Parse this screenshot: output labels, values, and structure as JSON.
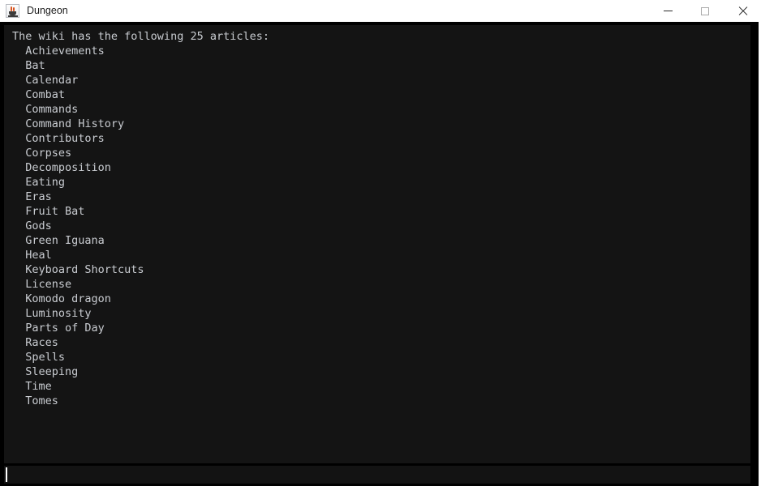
{
  "window": {
    "title": "Dungeon",
    "icon": "java-coffee-cup-icon",
    "colors": {
      "titlebar_bg": "#ffffff",
      "frame": "#000000",
      "console_bg": "#141414",
      "console_fg": "#c9ccd1",
      "input_bg": "#131313",
      "caret": "#ffffff"
    },
    "controls": {
      "minimize": "—",
      "maximize": "□",
      "close": "✕"
    }
  },
  "console": {
    "header": "The wiki has the following 25 articles:",
    "article_count": 25,
    "indent": "  ",
    "articles": [
      "Achievements",
      "Bat",
      "Calendar",
      "Combat",
      "Commands",
      "Command History",
      "Contributors",
      "Corpses",
      "Decomposition",
      "Eating",
      "Eras",
      "Fruit Bat",
      "Gods",
      "Green Iguana",
      "Heal",
      "Keyboard Shortcuts",
      "License",
      "Komodo dragon",
      "Luminosity",
      "Parts of Day",
      "Races",
      "Spells",
      "Sleeping",
      "Time",
      "Tomes"
    ],
    "full_text": "The wiki has the following 25 articles:\n  Achievements\n  Bat\n  Calendar\n  Combat\n  Commands\n  Command History\n  Contributors\n  Corpses\n  Decomposition\n  Eating\n  Eras\n  Fruit Bat\n  Gods\n  Green Iguana\n  Heal\n  Keyboard Shortcuts\n  License\n  Komodo dragon\n  Luminosity\n  Parts of Day\n  Races\n  Spells\n  Sleeping\n  Time\n  Tomes"
  },
  "input": {
    "value": "",
    "placeholder": ""
  }
}
